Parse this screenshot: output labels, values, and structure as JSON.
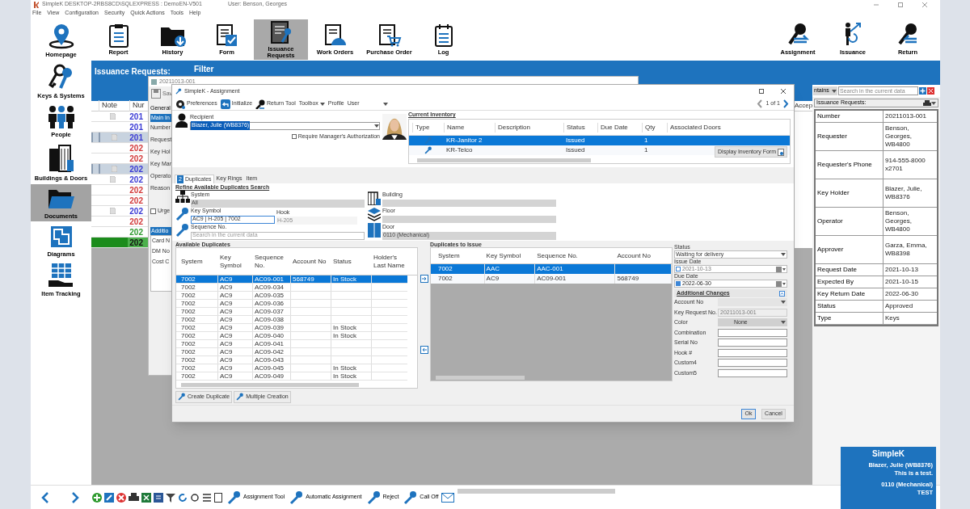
{
  "app": {
    "title": "SimpleK  DESKTOP-2RBS8CD\\SQLEXPRESS : DemoEN-V501",
    "user": "User: Benson, Georges"
  },
  "menu": [
    "File",
    "View",
    "Configuration",
    "Security",
    "Quick Actions",
    "Tools",
    "Help"
  ],
  "toolbar": [
    {
      "label": "Report",
      "selected": false
    },
    {
      "label": "History",
      "selected": false
    },
    {
      "label": "Form",
      "selected": false
    },
    {
      "label": "Issuance Requests",
      "selected": true
    },
    {
      "label": "Work Orders",
      "selected": false
    },
    {
      "label": "Purchase Order",
      "selected": false
    },
    {
      "label": "Log",
      "selected": false
    }
  ],
  "actions": [
    "Assignment",
    "Issuance",
    "Return"
  ],
  "sidebar": [
    {
      "label": "Homepage",
      "selected": false
    },
    {
      "label": "Keys & Systems",
      "selected": false
    },
    {
      "label": "People",
      "selected": false
    },
    {
      "label": "Buildings & Doors",
      "selected": false
    },
    {
      "label": "Documents",
      "selected": true
    },
    {
      "label": "Diagrams",
      "selected": false
    },
    {
      "label": "Item Tracking",
      "selected": false
    }
  ],
  "filter": {
    "title": "Filter",
    "heading": "Issuance Requests:"
  },
  "grid": {
    "columns": [
      "Note",
      "Nur"
    ],
    "last_column": "Accep",
    "rows": [
      {
        "note": true,
        "number": "201",
        "color": "#3a3ad4",
        "highlighted": false,
        "selected": false
      },
      {
        "note": false,
        "number": "201",
        "color": "#3a3ad4",
        "highlighted": false,
        "selected": false
      },
      {
        "note": true,
        "number": "201",
        "color": "#3a3ad4",
        "highlighted": true,
        "selected": false
      },
      {
        "note": false,
        "number": "202",
        "color": "#d23a3a",
        "highlighted": false,
        "selected": false
      },
      {
        "note": false,
        "number": "202",
        "color": "#d23a3a",
        "highlighted": false,
        "selected": false
      },
      {
        "note": true,
        "number": "202",
        "color": "#3a3ad4",
        "highlighted": true,
        "selected": false
      },
      {
        "note": true,
        "number": "202",
        "color": "#3a3ad4",
        "highlighted": false,
        "selected": false
      },
      {
        "note": false,
        "number": "202",
        "color": "#d23a3a",
        "highlighted": false,
        "selected": false
      },
      {
        "note": false,
        "number": "202",
        "color": "#d23a3a",
        "highlighted": false,
        "selected": false
      },
      {
        "note": true,
        "number": "202",
        "color": "#3a3ad4",
        "highlighted": false,
        "selected": false
      },
      {
        "note": false,
        "number": "202",
        "color": "#d23a3a",
        "highlighted": false,
        "selected": false
      },
      {
        "note": false,
        "number": "202",
        "color": "#2f9a2f",
        "highlighted": false,
        "selected": false
      },
      {
        "note": false,
        "number": "202",
        "highlighted": false,
        "selected": true
      }
    ]
  },
  "search": {
    "operator": "ntains",
    "placeholder": "Search in the current data"
  },
  "details": {
    "title": "Issuance Requests:",
    "rows": [
      {
        "label": "Number",
        "value": "20211013-001"
      },
      {
        "label": "Requester",
        "value": "Benson, Georges, WB4800"
      },
      {
        "label": "Requester's Phone",
        "value": "914-555-8000 x2701"
      },
      {
        "label": "Key Holder",
        "value": "Blazer, Julie, WB8376"
      },
      {
        "label": "Operator",
        "value": "Benson, Georges, WB4800"
      },
      {
        "label": "Approver",
        "value": "Garza, Emma, WB8398"
      },
      {
        "label": "Request Date",
        "value": "2021-10-13"
      },
      {
        "label": "Expected By",
        "value": "2021-10-15"
      },
      {
        "label": "Key Return Date",
        "value": "2022-06-30"
      },
      {
        "label": "Status",
        "value": "Approved"
      },
      {
        "label": "Type",
        "value": "Keys"
      }
    ]
  },
  "request_window": {
    "title": "20211013-001",
    "save": "Sav",
    "tab": "General",
    "section": "Main In",
    "labels": [
      "Number",
      "Request",
      "Key Hol",
      "Key Man",
      "Operato",
      "Reason"
    ],
    "urgent": {
      "label": "Urge",
      "checked": false
    },
    "additional": "Additio",
    "labels2": [
      "Card N",
      "DM No",
      "Cost C"
    ]
  },
  "assignment": {
    "title": "SimpleK - Assignment",
    "toolbar": [
      {
        "label": "Preferences"
      },
      {
        "label": "Initialize"
      },
      {
        "label": "Return Tool"
      },
      {
        "label": "Toolbox"
      },
      {
        "label": "Profile"
      }
    ],
    "profile": "User",
    "pager": "1 of 1",
    "recipient": {
      "label": "Recipient",
      "value": "Blazer, Julie (WB8376)"
    },
    "manager_auth": {
      "label": "Require Manager's Authorization",
      "checked": false
    },
    "inventory": {
      "title": "Current Inventory",
      "columns": [
        "Type",
        "Name",
        "Description",
        "Status",
        "Due Date",
        "Qty",
        "Associated Doors"
      ],
      "rows": [
        {
          "name": "KR-Janitor 2",
          "status": "Issued",
          "qty": "1",
          "selected": true
        },
        {
          "name": "KR-Telco",
          "status": "Issued",
          "qty": "1",
          "selected": false
        }
      ],
      "button": "Display Inventory Form"
    },
    "tabs": [
      {
        "label": "Duplicates",
        "badge": "2",
        "selected": true
      },
      {
        "label": "Key Rings",
        "selected": false
      },
      {
        "label": "Item",
        "selected": false
      }
    ],
    "refine": {
      "title": "Refine Available Duplicates Search",
      "system": {
        "label": "System",
        "value": "All"
      },
      "building": {
        "label": "Building"
      },
      "key_symbol": {
        "label": "Key Symbol",
        "value": "AC9 | H-205 | 7002"
      },
      "hook": {
        "label": "Hook",
        "value": "H-205"
      },
      "floor": {
        "label": "Floor"
      },
      "sequence": {
        "label": "Sequence No.",
        "placeholder": "Search in the current data"
      },
      "door": {
        "label": "Door",
        "value": "0110 (Mechanical)"
      }
    },
    "available": {
      "title": "Available Duplicates",
      "columns": [
        "System",
        "Key Symbol",
        "Sequence No.",
        "Account No",
        "Status",
        "Holder's Last Name"
      ],
      "rows": [
        {
          "system": "7002",
          "key_symbol": "AC9",
          "sequence_no": "AC09-001",
          "account_no": "568749",
          "status": "In Stock",
          "selected": true
        },
        {
          "system": "7002",
          "key_symbol": "AC9",
          "sequence_no": "AC09-034",
          "selected": false
        },
        {
          "system": "7002",
          "key_symbol": "AC9",
          "sequence_no": "AC09-035",
          "selected": false
        },
        {
          "system": "7002",
          "key_symbol": "AC9",
          "sequence_no": "AC09-036",
          "selected": false
        },
        {
          "system": "7002",
          "key_symbol": "AC9",
          "sequence_no": "AC09-037",
          "selected": false
        },
        {
          "system": "7002",
          "key_symbol": "AC9",
          "sequence_no": "AC09-038",
          "selected": false
        },
        {
          "system": "7002",
          "key_symbol": "AC9",
          "sequence_no": "AC09-039",
          "status": "In Stock",
          "selected": false
        },
        {
          "system": "7002",
          "key_symbol": "AC9",
          "sequence_no": "AC09-040",
          "status": "In Stock",
          "selected": false
        },
        {
          "system": "7002",
          "key_symbol": "AC9",
          "sequence_no": "AC09-041",
          "selected": false
        },
        {
          "system": "7002",
          "key_symbol": "AC9",
          "sequence_no": "AC09-042",
          "selected": false
        },
        {
          "system": "7002",
          "key_symbol": "AC9",
          "sequence_no": "AC09-043",
          "selected": false
        },
        {
          "system": "7002",
          "key_symbol": "AC9",
          "sequence_no": "AC09-045",
          "status": "In Stock",
          "selected": false
        },
        {
          "system": "7002",
          "key_symbol": "AC9",
          "sequence_no": "AC09-049",
          "status": "In Stock",
          "selected": false
        }
      ]
    },
    "to_issue": {
      "title": "Duplicates to Issue",
      "columns": [
        "System",
        "Key Symbol",
        "Sequence No.",
        "Account No"
      ],
      "rows": [
        {
          "system": "7002",
          "key_symbol": "AAC",
          "sequence_no": "AAC-001",
          "selected": true
        },
        {
          "system": "7002",
          "key_symbol": "AC9",
          "sequence_no": "AC09-001",
          "account_no": "568749",
          "selected": false
        }
      ]
    },
    "form": {
      "status": {
        "label": "Status",
        "value": "Waiting for delivery"
      },
      "issue_date": {
        "label": "Issue Date",
        "value": "2021-10-13",
        "checked": false
      },
      "due_date": {
        "label": "Due Date",
        "value": "2022-06-30",
        "checked": true
      },
      "additional": "Additional Changes",
      "fields": [
        {
          "label": "Account No",
          "kind": "select",
          "disabled": true
        },
        {
          "label": "Key Request No.",
          "value": "20211013-001",
          "kind": "text",
          "disabled": true
        },
        {
          "label": "Color",
          "value": "None",
          "kind": "select",
          "disabled": false
        },
        {
          "label": "Combination",
          "kind": "text",
          "disabled": false
        },
        {
          "label": "Serial No",
          "kind": "text",
          "disabled": false
        },
        {
          "label": "Hook #",
          "kind": "text",
          "disabled": false
        },
        {
          "label": "Custom4",
          "kind": "text",
          "disabled": false
        },
        {
          "label": "Custom5",
          "kind": "text",
          "disabled": false
        }
      ]
    },
    "buttons": [
      "Create Duplicate",
      "Multiple Creation"
    ],
    "ok": "Ok",
    "cancel": "Cancel"
  },
  "bottom_bar": {
    "tools": [
      "Assignment Tool",
      "Automatic Assignment",
      "Reject",
      "Call Off"
    ]
  },
  "notification": {
    "title": "SimpleK",
    "lines": [
      "Blazer, Julie (WB8376)",
      "This is a test.",
      "0110 (Mechanical)",
      "TEST"
    ]
  }
}
